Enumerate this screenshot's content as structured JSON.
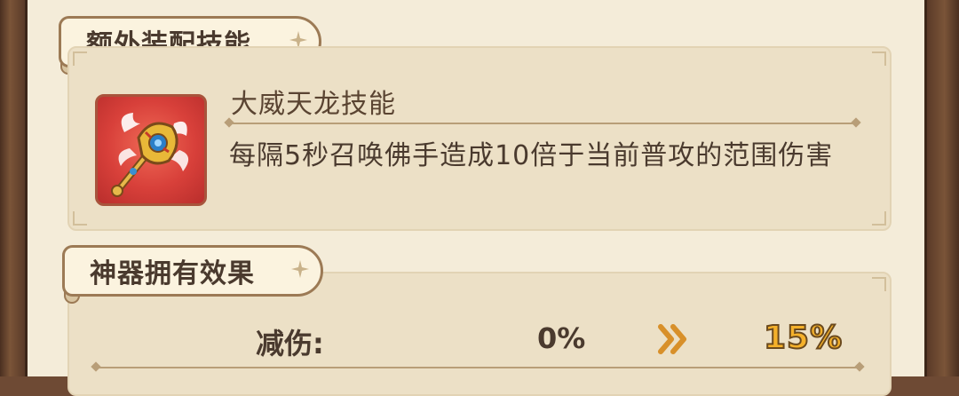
{
  "extra_skill_section": {
    "title": "额外装配技能",
    "skill_name": "大威天龙技能",
    "skill_icon": "golden-mace-weapon-icon",
    "description": "每隔5秒召唤佛手造成10倍于当前普攻的范围伤害"
  },
  "artifact_section": {
    "title": "神器拥有效果",
    "stat": {
      "label": "减伤:",
      "current": "0%",
      "arrow_icon": "double-chevron-right-icon",
      "next": "15%"
    }
  },
  "colors": {
    "panel_bg": "#f4ecd9",
    "box_bg": "#ece0c6",
    "text_dark": "#4a3a2e",
    "highlight": "#f5b12a",
    "icon_bg": "#d8403a",
    "frame_wood": "#6e4a34"
  }
}
